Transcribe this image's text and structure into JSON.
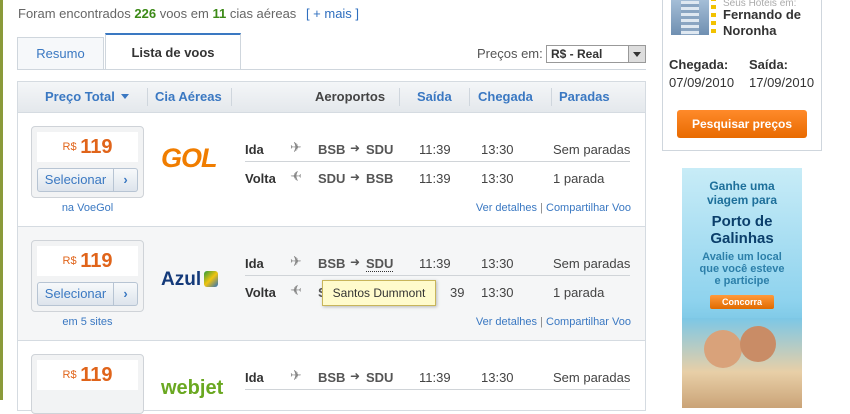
{
  "summary": {
    "prefix": "Foram encontrados",
    "count": "226",
    "middle": "voos em",
    "airlines": "11",
    "suffix": "cias aéreas",
    "more": "[ + mais ]"
  },
  "tabs": [
    {
      "label": "Resumo",
      "active": false
    },
    {
      "label": "Lista de voos",
      "active": true
    }
  ],
  "prices_in": {
    "label": "Preços em:",
    "value": "R$ - Real"
  },
  "header": {
    "price_total": "Preço Total",
    "airline": "Cia Aéreas",
    "airports": "Aeroportos",
    "departure": "Saída",
    "arrival": "Chegada",
    "stops": "Paradas"
  },
  "results": [
    {
      "currency": "R$",
      "price": "119",
      "select": "Selecionar",
      "site": "na VoeGol",
      "airline_logo": "GOL",
      "legs": [
        {
          "label": "Ida",
          "from": "BSB",
          "to": "SDU",
          "dep": "11:39",
          "arr": "13:30",
          "stops": "Sem paradas"
        },
        {
          "label": "Volta",
          "from": "SDU",
          "to": "BSB",
          "dep": "11:39",
          "arr": "13:30",
          "stops": "1 parada"
        }
      ],
      "details": "Ver detalhes",
      "share": "Compartilhar Voo"
    },
    {
      "currency": "R$",
      "price": "119",
      "select": "Selecionar",
      "site": "em 5 sites",
      "airline_logo": "Azul",
      "legs": [
        {
          "label": "Ida",
          "from": "BSB",
          "to": "SDU",
          "dep": "11:39",
          "arr": "13:30",
          "stops": "Sem paradas"
        },
        {
          "label": "Volta",
          "from": "S",
          "to": "",
          "dep": "39",
          "arr": "13:30",
          "stops": "1 parada"
        }
      ],
      "details": "Ver detalhes",
      "share": "Compartilhar Voo"
    },
    {
      "currency": "R$",
      "price": "119",
      "select": "",
      "site": "",
      "airline_logo": "webjet",
      "legs": [
        {
          "label": "Ida",
          "from": "BSB",
          "to": "SDU",
          "dep": "11:39",
          "arr": "13:30",
          "stops": "Sem paradas"
        }
      ]
    }
  ],
  "tooltip": "Santos Dummont",
  "hotel": {
    "top_text": "Seus Hotéis em:",
    "destination_line1": "Fernando de",
    "destination_line2": "Noronha",
    "checkin_label": "Chegada:",
    "checkin_date": "07/09/2010",
    "checkout_label": "Saída:",
    "checkout_date": "17/09/2010",
    "button": "Pesquisar preços"
  },
  "ad": {
    "line1a": "Ganhe uma",
    "line1b": "viagem para",
    "line2a": "Porto de",
    "line2b": "Galinhas",
    "line3a": "Avalie um local",
    "line3b": "que você esteve",
    "line3c": "e participe",
    "button": "Concorra"
  },
  "colors": {
    "accent_blue": "#3a78c2",
    "price_orange": "#e0641a",
    "count_green": "#3c8a17",
    "button_orange": "#f07a12"
  }
}
